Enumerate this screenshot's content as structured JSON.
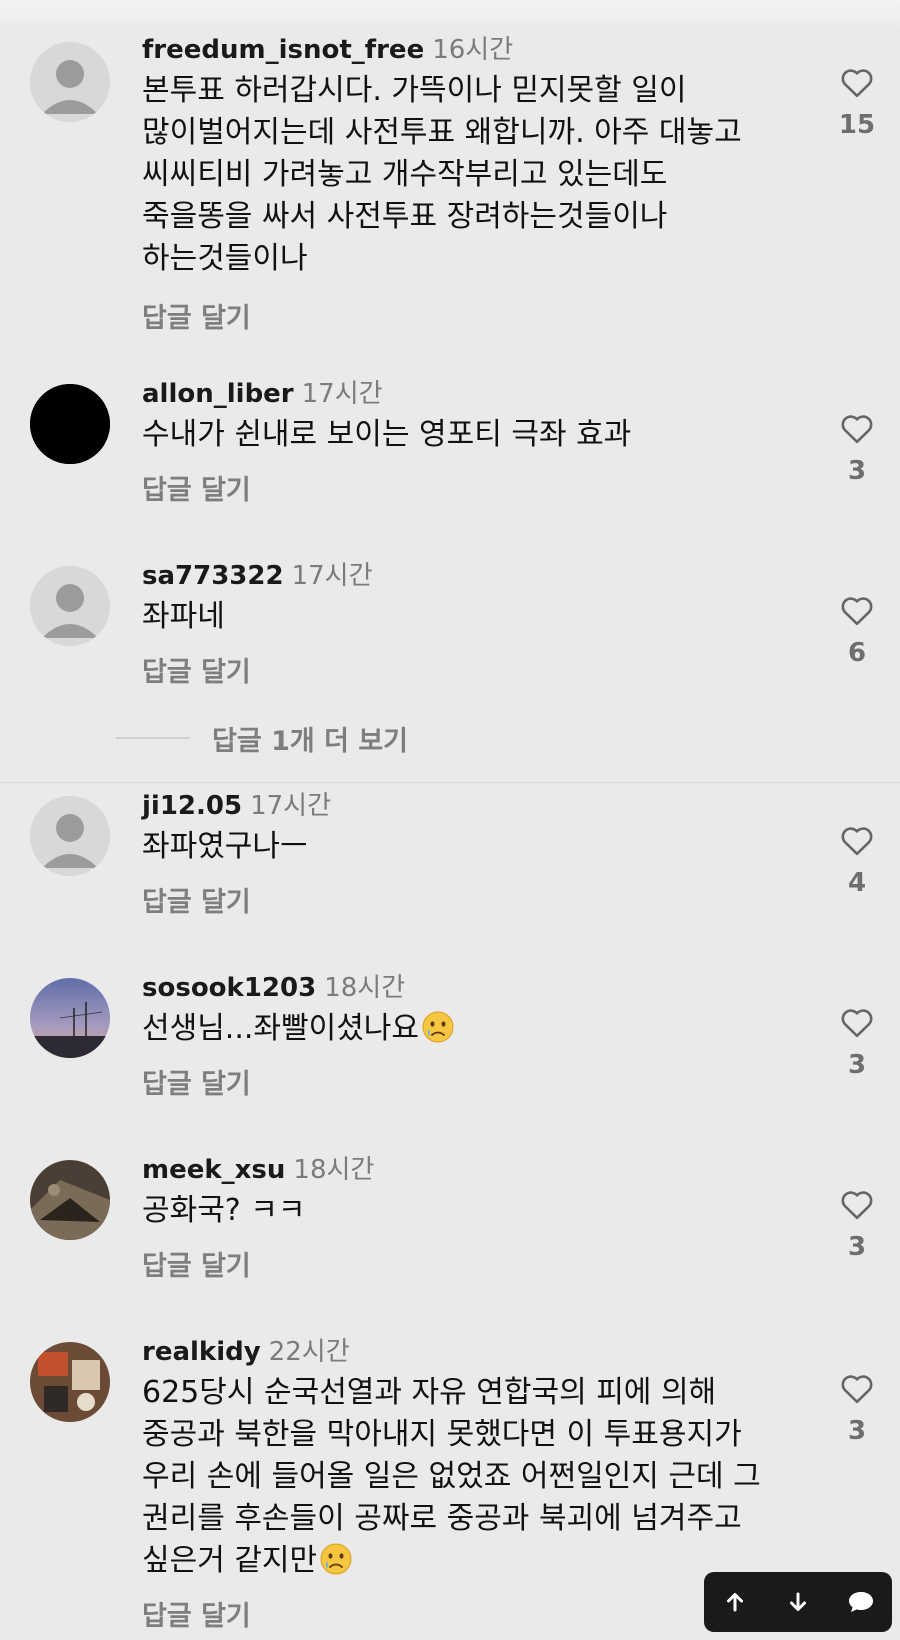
{
  "comments": [
    {
      "username": "freedum_isnot_free",
      "time": "16시간",
      "lines": [
        "본투표 하러갑시다. 가뜩이나 믿지못할 일이",
        "많이벌어지는데 사전투표 왜합니까. 아주 대놓고",
        "씨씨티비 가려놓고 개수작부리고 있는데도",
        "죽을똥을 싸서 사전투표 장려하는것들이나",
        "하는것들이나"
      ],
      "reply_label": "답글 달기",
      "likes": "15",
      "avatar": "default"
    },
    {
      "username": "allon_liber",
      "time": "17시간",
      "lines": [
        "수내가 쉰내로 보이는 영포티 극좌 효과"
      ],
      "reply_label": "답글 달기",
      "likes": "3",
      "avatar": "black"
    },
    {
      "username": "sa773322",
      "time": "17시간",
      "lines": [
        "좌파네"
      ],
      "reply_label": "답글 달기",
      "likes": "6",
      "avatar": "default"
    },
    {
      "username": "ji12.05",
      "time": "17시간",
      "lines": [
        "좌파였구나ㅡ"
      ],
      "reply_label": "답글 달기",
      "likes": "4",
      "avatar": "default"
    },
    {
      "username": "sosook1203",
      "time": "18시간",
      "lines": [
        "선생님...좌빨이셨나요"
      ],
      "reply_label": "답글 달기",
      "likes": "3",
      "avatar": "sunset-photo",
      "emoji": "crying-face"
    },
    {
      "username": "meek_xsu",
      "time": "18시간",
      "lines": [
        "공화국? ㅋㅋ"
      ],
      "reply_label": "답글 달기",
      "likes": "3",
      "avatar": "dark-photo"
    },
    {
      "username": "realkidy",
      "time": "22시간",
      "lines": [
        "625당시 순국선열과 자유 연합국의 피에 의해",
        "중공과 북한을 막아내지 못했다면 이 투표용지가",
        "우리 손에 들어올 일은 없었죠 어쩐일인지 근데 그",
        "권리를 후손들이 공짜로 중공과 북괴에 넘겨주고",
        "싶은거 같지만"
      ],
      "reply_label": "답글 달기",
      "likes": "3",
      "avatar": "photo-red",
      "emoji": "crying-face"
    }
  ],
  "more_replies_label": "답글 1개 더 보기",
  "floating_bar": {
    "buttons": [
      "arrow-up-icon",
      "arrow-down-icon",
      "chat-bubble-icon"
    ]
  },
  "colors": {
    "background": "#eaeaea",
    "muted_text": "#7e7e7e",
    "floating_bar": "#1a1a1a"
  }
}
